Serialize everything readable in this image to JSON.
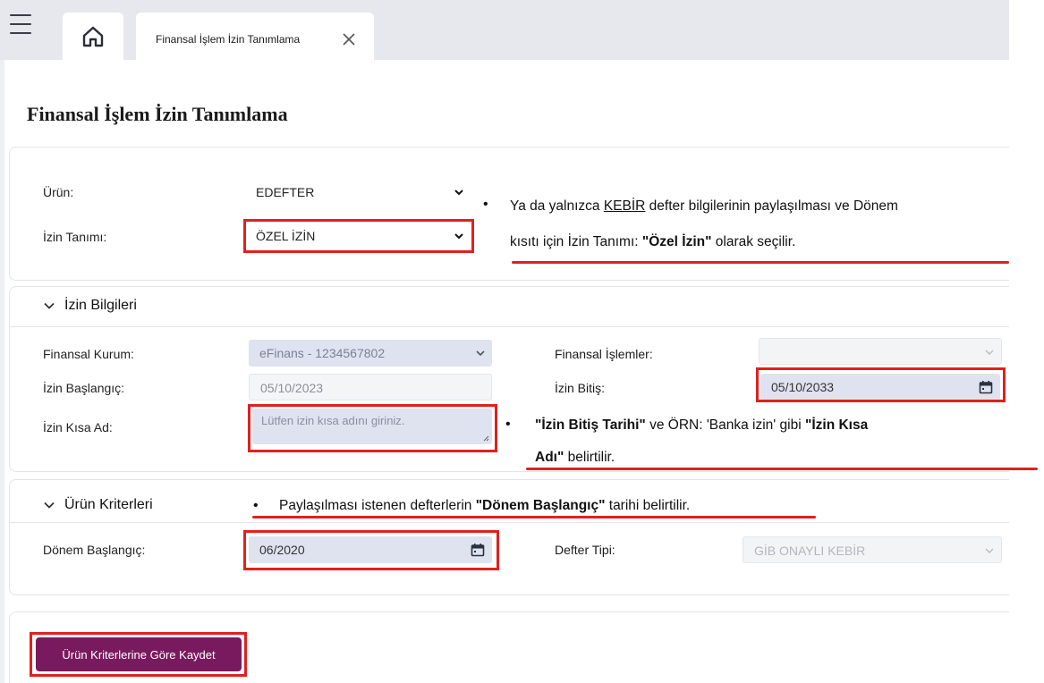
{
  "header": {
    "tab_label": "Finansal İşlem İzin Tanımlama"
  },
  "page": {
    "title": "Finansal İşlem İzin Tanımlama"
  },
  "general": {
    "product_label": "Ürün:",
    "product_value": "EDEFTER",
    "permission_label": "İzin Tanımı:",
    "permission_value": "ÖZEL İZİN"
  },
  "permission_info": {
    "section_title": "İzin Bilgileri",
    "institution_label": "Finansal Kurum:",
    "institution_value": "eFinans - 1234567802",
    "operations_label": "Finansal İşlemler:",
    "operations_value": "",
    "start_label": "İzin Başlangıç:",
    "start_value": "05/10/2023",
    "end_label": "İzin Bitiş:",
    "end_value": "05/10/2033",
    "short_name_label": "İzin Kısa Ad:",
    "short_name_placeholder": "Lütfen izin kısa adını giriniz."
  },
  "product_criteria": {
    "section_title": "Ürün Kriterleri",
    "period_start_label": "Dönem Başlangıç:",
    "period_start_value": "06/2020",
    "ledger_type_label": "Defter Tipi:",
    "ledger_type_value": "GİB ONAYLI KEBİR"
  },
  "actions": {
    "save_label": "Ürün Kriterlerine Göre Kaydet"
  },
  "annotations": {
    "note1_a": "Ya da yalnızca ",
    "note1_b": "KEBİR",
    "note1_c": " defter bilgilerinin paylaşılması ve Dönem",
    "note1_d": "kısıtı için İzin Tanımı: ",
    "note1_e": "\"Özel İzin\"",
    "note1_f": " olarak seçilir.",
    "note2_a": "\"İzin Bitiş Tarihi\"",
    "note2_b": " ve ÖRN: 'Banka izin' gibi ",
    "note2_c": "\"İzin Kısa",
    "note2_d": "Adı\"",
    "note2_e": " belirtilir.",
    "note3_a": "Paylaşılması istenen defterlerin ",
    "note3_b": "\"Dönem Başlangıç\"",
    "note3_c": " tarihi belirtilir.",
    "bullet": "•"
  },
  "colors": {
    "accent": "#7a1a5e",
    "highlight": "#e02020",
    "field_bg": "#dfe3ef"
  },
  "icons": {
    "menu": "menu-icon",
    "home": "home-icon",
    "close": "close-icon",
    "chevron": "chevron-down-icon",
    "calendar": "calendar-icon"
  }
}
